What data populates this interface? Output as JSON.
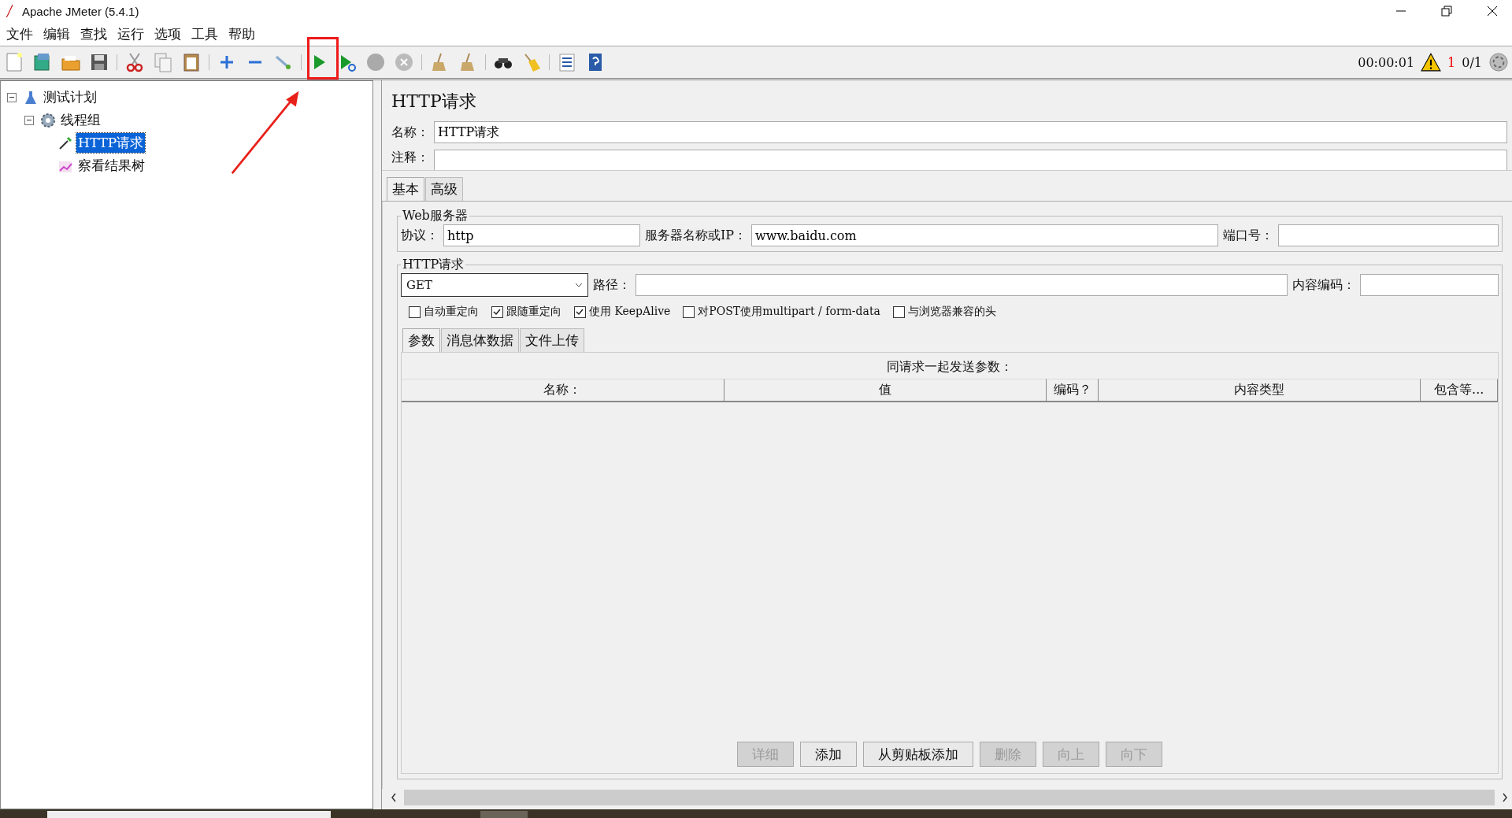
{
  "window": {
    "title": "Apache JMeter (5.4.1)"
  },
  "menu": [
    "文件",
    "编辑",
    "查找",
    "运行",
    "选项",
    "工具",
    "帮助"
  ],
  "status": {
    "elapsed": "00:00:01",
    "warning_count": "1",
    "threads": "0/1"
  },
  "tree": [
    {
      "label": "测试计划",
      "kind": "plan",
      "expanded": true,
      "selected": false,
      "children": [
        {
          "label": "线程组",
          "kind": "threads",
          "expanded": true,
          "selected": false,
          "children": [
            {
              "label": "HTTP请求",
              "kind": "sampler",
              "selected": true
            },
            {
              "label": "察看结果树",
              "kind": "listener",
              "selected": false
            }
          ]
        }
      ]
    }
  ],
  "panel": {
    "title": "HTTP请求",
    "name_label": "名称：",
    "name_value": "HTTP请求",
    "comment_label": "注释：",
    "tabs": [
      {
        "label": "基本",
        "selected": true
      },
      {
        "label": "高级",
        "selected": false
      }
    ],
    "web_server": {
      "title": "Web服务器",
      "protocol_label": "协议：",
      "protocol_value": "http",
      "server_label": "服务器名称或IP：",
      "server_value": "www.baidu.com",
      "port_label": "端口号："
    },
    "http_request": {
      "title": "HTTP请求",
      "method": "GET",
      "path_label": "路径：",
      "encoding_label": "内容编码：",
      "options": [
        {
          "label": "自动重定向",
          "checked": false
        },
        {
          "label": "跟随重定向",
          "checked": true
        },
        {
          "label": "使用 KeepAlive",
          "checked": true
        },
        {
          "label": "对POST使用multipart / form-data",
          "checked": false
        },
        {
          "label": "与浏览器兼容的头",
          "checked": false
        }
      ],
      "subtabs": [
        {
          "label": "参数",
          "selected": true
        },
        {
          "label": "消息体数据",
          "selected": false
        },
        {
          "label": "文件上传",
          "selected": false
        }
      ],
      "table_caption": "同请求一起发送参数：",
      "columns": [
        "名称：",
        "值",
        "编码？",
        "内容类型",
        "包含等..."
      ],
      "buttons": [
        {
          "label": "详细",
          "disabled": true
        },
        {
          "label": "添加",
          "disabled": false
        },
        {
          "label": "从剪贴板添加",
          "disabled": false
        },
        {
          "label": "删除",
          "disabled": true
        },
        {
          "label": "向上",
          "disabled": true
        },
        {
          "label": "向下",
          "disabled": true
        }
      ]
    }
  }
}
